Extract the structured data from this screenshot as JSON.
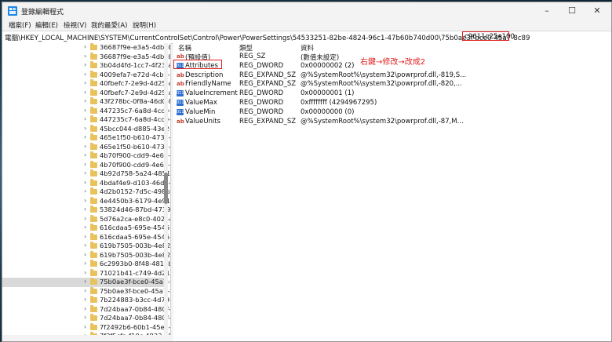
{
  "window": {
    "title": "登錄編輯程式",
    "controls": {
      "minimize": "–",
      "maximize": "☐",
      "close": "✕"
    }
  },
  "menu": [
    "檔案(F)",
    "編輯(E)",
    "檢視(V)",
    "我的最愛(A)",
    "說明(H)"
  ],
  "address": {
    "path": "電腦\\HKEY_LOCAL_MACHINE\\SYSTEM\\CurrentControlSet\\Control\\Power\\PowerSettings\\54533251-82be-4824-96c1-47b60b740d00\\75b0ae3f-bce0-45a7-8c89",
    "highlighted": "c9611c25e100"
  },
  "tree": {
    "items": [
      "36687f9e-e3a5-4dbf-b1d",
      "36687f9e-e3a5-4dbf-b1d",
      "3b04d4fd-1cc7-4f23-ab1",
      "4009efa7-e72d-4cba-9e",
      "40fbefc7-2e9d-4d25-a18",
      "40fbefc7-2e9d-4d25-a18",
      "43f278bc-0f8a-46d0-8b3",
      "447235c7-6a8d-4cc0-8e2",
      "447235c7-6a8d-4cc0-8e2",
      "45bcc044-d885-43e2-860",
      "465e1f50-b610-473a-ab5",
      "465e1f50-b610-473a-ab5",
      "4b70f900-cdd9-4e66-aa2",
      "4b70f900-cdd9-4e66-aa2",
      "4b92d758-5a24-4851-a4",
      "4bdaf4e9-d103-46d7-a5f",
      "4d2b0152-7d5c-498b-88",
      "4e4450b3-6179-4e91-b8",
      "53824d46-87bd-4739-aa",
      "5d76a2ca-e8c0-402f-a13",
      "616cdaa5-695e-4545-97a",
      "616cdaa5-695e-4545-97a",
      "619b7505-003b-4e82-b7",
      "619b7505-003b-4e82-b7",
      "6c2993b0-8f48-481f-bcc",
      "71021b41-c749-4d21-be",
      "75b0ae3f-bce0-45a7-8c8",
      "75b0ae3f-bce0-45a7-8c8",
      "7b224883-b3cc-4d79-819",
      "7d24baa7-0b84-480f-840",
      "7d24baa7-0b84-480f-840",
      "7f2492b6-60b1-45e5-ae5",
      "7f2f5cfa-f10c-4823-b5e1"
    ],
    "selected_index": 26
  },
  "values": {
    "headers": {
      "name": "名稱",
      "type": "類型",
      "data": "資料"
    },
    "rows": [
      {
        "icon": "string-value-icon",
        "name": "(預設值)",
        "type": "REG_SZ",
        "data": "(數值未設定)"
      },
      {
        "icon": "binary-value-icon",
        "name": "Attributes",
        "type": "REG_DWORD",
        "data": "0x00000002 (2)"
      },
      {
        "icon": "string-value-icon",
        "name": "Description",
        "type": "REG_EXPAND_SZ",
        "data": "@%SystemRoot%\\system32\\powrprof.dll,-819,S..."
      },
      {
        "icon": "string-value-icon",
        "name": "FriendlyName",
        "type": "REG_EXPAND_SZ",
        "data": "@%SystemRoot%\\system32\\powrprof.dll,-820,..."
      },
      {
        "icon": "binary-value-icon",
        "name": "ValueIncrement",
        "type": "REG_DWORD",
        "data": "0x00000001 (1)"
      },
      {
        "icon": "binary-value-icon",
        "name": "ValueMax",
        "type": "REG_DWORD",
        "data": "0xffffffff (4294967295)"
      },
      {
        "icon": "binary-value-icon",
        "name": "ValueMin",
        "type": "REG_DWORD",
        "data": "0x00000000 (0)"
      },
      {
        "icon": "string-value-icon",
        "name": "ValueUnits",
        "type": "REG_EXPAND_SZ",
        "data": "@%SystemRoot%\\system32\\powrprof.dll,-87,M..."
      }
    ]
  },
  "annotation": "右鍵→修改→改成2",
  "colors": {
    "highlight": "#e02020",
    "selection": "#d9d9d9",
    "folder": "#e8c25a"
  }
}
